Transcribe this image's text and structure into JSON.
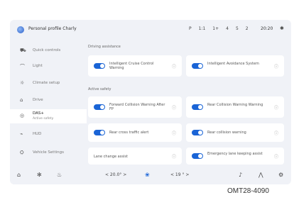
{
  "status_bar": {
    "profile": "Personal profile Charly",
    "icons": [
      "P",
      "1:1",
      "1+",
      "4",
      "5",
      "2"
    ],
    "clock": "20:20",
    "bt_icon": "bluetooth-icon"
  },
  "sidebar": {
    "items": [
      {
        "icon": "⛟",
        "label": "Quick controls"
      },
      {
        "icon": "⌒",
        "label": "Light"
      },
      {
        "icon": "☼",
        "label": "Climate setup"
      },
      {
        "icon": "⌂",
        "label": "Drive"
      },
      {
        "icon": "◎",
        "label": "DAS+",
        "sub": "Active safety"
      },
      {
        "icon": "⌁",
        "label": "HUD"
      },
      {
        "icon": "⛭",
        "label": "Vehicle Settings"
      }
    ]
  },
  "sections": {
    "top": "Driving assistance",
    "middle": "Active safety"
  },
  "cards": [
    {
      "label": "Intelligent Cruise Control Warning"
    },
    {
      "label": "Intelligent Avoidance System"
    },
    {
      "label": "Forward Collision Warning After FP"
    },
    {
      "label": "Rear Collision Warning Warning"
    },
    {
      "label": "Rear cross traffic alert"
    },
    {
      "label": "Rear collision warning"
    },
    {
      "label": "Lane change assist"
    },
    {
      "label": "Emergency lane keeping assist"
    }
  ],
  "bottom_bar": {
    "left_temp": "< 20.0° >",
    "right_temp": "< 19 ° >"
  },
  "caption": "OMT28-4090"
}
